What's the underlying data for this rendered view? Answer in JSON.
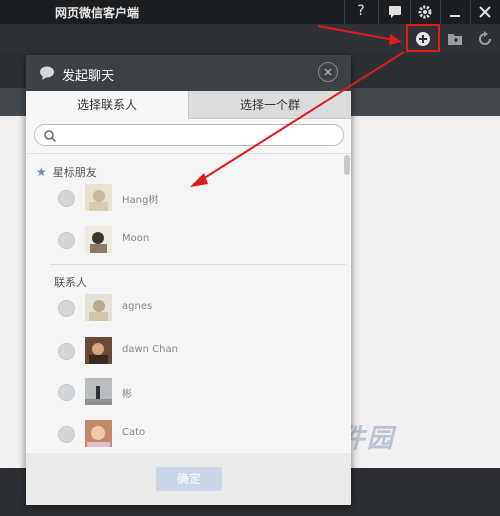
{
  "window": {
    "title": "网页微信客户端",
    "help_label": "?"
  },
  "dialog": {
    "title": "发起聊天",
    "tabs": [
      {
        "label": "选择联系人"
      },
      {
        "label": "选择一个群"
      }
    ],
    "search": {
      "placeholder": ""
    },
    "sections": {
      "starred": "星标朋友",
      "contacts": "联系人"
    },
    "starred_friends": [
      {
        "name": "Hang树"
      },
      {
        "name": "Moon"
      }
    ],
    "contacts": [
      {
        "name": "agnes"
      },
      {
        "name": "dawn Chan"
      },
      {
        "name": "彬"
      },
      {
        "name": "Cato"
      }
    ],
    "confirm_label": "确定"
  },
  "watermark": {
    "text": "新手软件园"
  },
  "colors": {
    "annotation": "#e01b1b",
    "titlebar": "#1c1f22",
    "dialog_header": "#3d4246"
  }
}
